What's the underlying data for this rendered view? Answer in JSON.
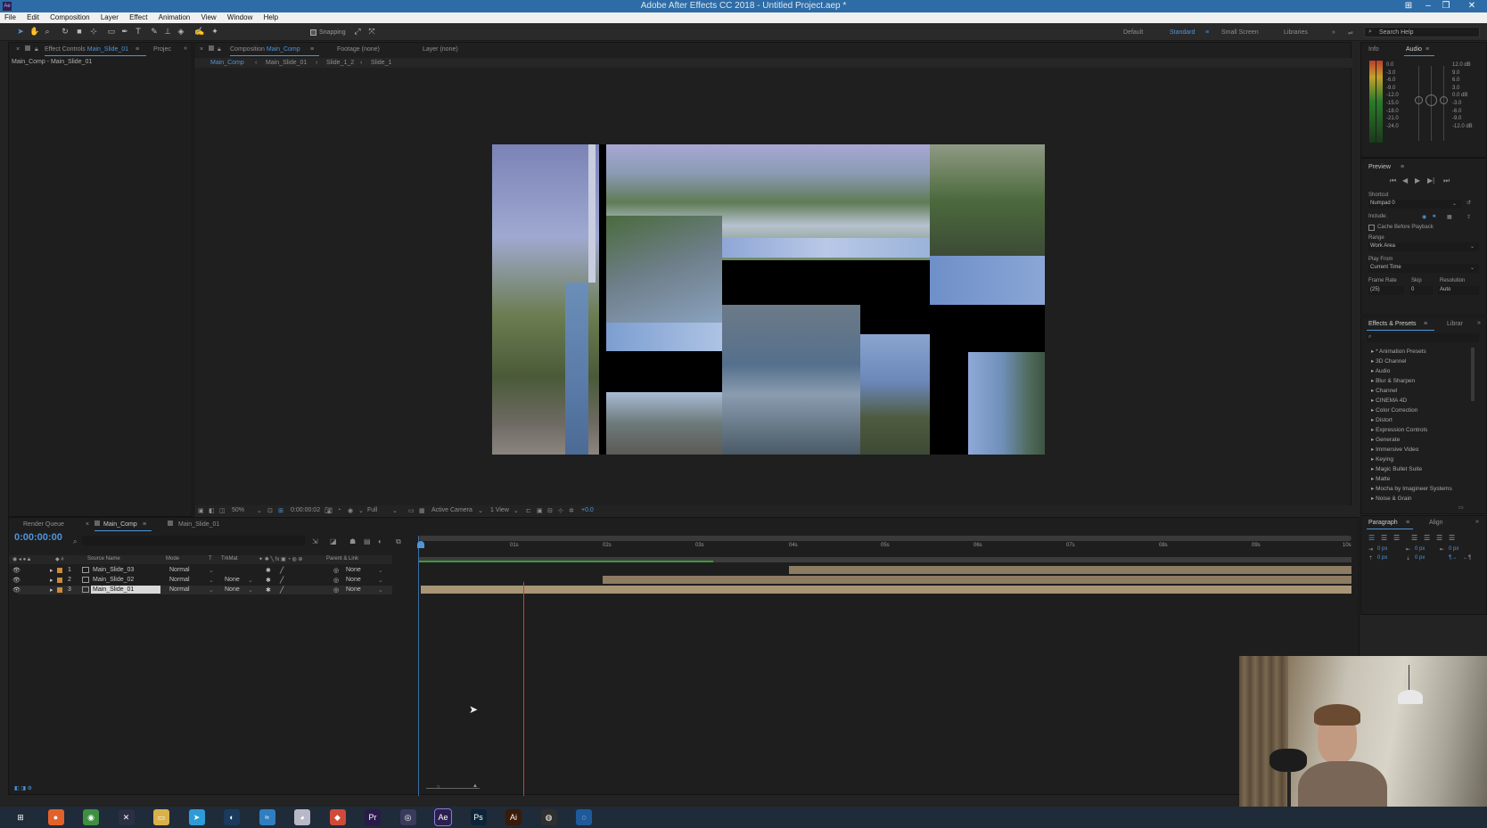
{
  "app": {
    "title": "Adobe After Effects CC 2018 - Untitled Project.aep *",
    "menu": [
      "File",
      "Edit",
      "Composition",
      "Layer",
      "Effect",
      "Animation",
      "View",
      "Window",
      "Help"
    ],
    "snapping": "Snapping",
    "workspaces": [
      "Default",
      "Standard",
      "Small Screen",
      "Libraries"
    ],
    "search_help": "Search Help"
  },
  "left_panel": {
    "tab_effect_controls": "Effect Controls",
    "tab_effect_controls_layer": "Main_Slide_01",
    "tab_project": "Projec",
    "subtitle": "Main_Comp - Main_Slide_01"
  },
  "viewer": {
    "tab_composition": "Composition",
    "tab_composition_name": "Main_Comp",
    "tab_footage": "Footage (none)",
    "tab_layer": "Layer (none)",
    "breadcrumb": [
      "Main_Comp",
      "Main_Slide_01",
      "Slide_1_2",
      "Slide_1"
    ],
    "zoom": "50%",
    "timecode": "0:00:00:02",
    "resolution": "Full",
    "camera": "Active Camera",
    "views": "1 View",
    "exposure": "+0.0"
  },
  "timeline": {
    "tab_render_queue": "Render Queue",
    "tab_main_comp": "Main_Comp",
    "tab_main_slide": "Main_Slide_01",
    "current_time": "0:00:00:00",
    "columns": {
      "source_name": "Source Name",
      "mode": "Mode",
      "t": "T",
      "trkmat": "TrkMat",
      "parent": "Parent & Link"
    },
    "layers": [
      {
        "num": "1",
        "name": "Main_Slide_03",
        "mode": "Normal",
        "trkmat": "",
        "parent": "None"
      },
      {
        "num": "2",
        "name": "Main_Slide_02",
        "mode": "Normal",
        "trkmat": "None",
        "parent": "None"
      },
      {
        "num": "3",
        "name": "Main_Slide_01",
        "mode": "Normal",
        "trkmat": "None",
        "parent": "None"
      }
    ],
    "ruler": [
      "0s",
      "01s",
      "02s",
      "03s",
      "04s",
      "05s",
      "06s",
      "07s",
      "08s",
      "09s",
      "10s"
    ]
  },
  "right_panel": {
    "info_tab": "Info",
    "audio_tab": "Audio",
    "audio_left_levels": [
      "0.0",
      "-3.0",
      "-6.0",
      "-9.0",
      "-12.0",
      "-15.0",
      "-18.0",
      "-21.0",
      "-24.0"
    ],
    "audio_right_levels": [
      "12.0 dB",
      "9.0",
      "6.0",
      "3.0",
      "0.0 dB",
      "-3.0",
      "-6.0",
      "-9.0",
      "-12.0 dB"
    ],
    "preview_tab": "Preview",
    "shortcut_label": "Shortcut",
    "shortcut_value": "Numpad 0",
    "include_label": "Include:",
    "cache_label": "Cache Before Playback",
    "range_label": "Range",
    "range_value": "Work Area",
    "play_from_label": "Play From",
    "play_from_value": "Current Time",
    "frame_rate_label": "Frame Rate",
    "skip_label": "Skip",
    "resolution_label": "Resolution",
    "frame_rate_value": "(25)",
    "skip_value": "0",
    "resolution_value": "Auto",
    "effects_tab": "Effects & Presets",
    "libraries_tab": "Librar",
    "effects": [
      "* Animation Presets",
      "3D Channel",
      "Audio",
      "Blur & Sharpen",
      "Channel",
      "CINEMA 4D",
      "Color Correction",
      "Distort",
      "Expression Controls",
      "Generate",
      "Immersive Video",
      "Keying",
      "Magic Bullet Suite",
      "Matte",
      "Mocha by Imagineer Systems",
      "Noise & Grain"
    ],
    "paragraph_tab": "Paragraph",
    "align_tab": "Align",
    "para_values": [
      "0 px",
      "0 px",
      "0 px",
      "0 px",
      "0 px"
    ]
  },
  "taskbar": {
    "apps": [
      {
        "icon": "windows-start-icon",
        "label": "⊞",
        "color": "#1f2b38"
      },
      {
        "icon": "firefox-icon",
        "label": "●",
        "color": "#e2612a"
      },
      {
        "icon": "chrome-icon",
        "label": "◉",
        "color": "#3d8f41"
      },
      {
        "icon": "terminal-icon",
        "label": "✕",
        "color": "#2a2f45"
      },
      {
        "icon": "file-explorer-icon",
        "label": "▭",
        "color": "#d8b14a"
      },
      {
        "icon": "telegram-icon",
        "label": "➤",
        "color": "#2d9bd8"
      },
      {
        "icon": "steam-icon",
        "label": "◐",
        "color": "#1b3a5c"
      },
      {
        "icon": "cloud-app-icon",
        "label": "≈",
        "color": "#2f7fc0"
      },
      {
        "icon": "app-icon-8",
        "label": "◕",
        "color": "#b8b8c8"
      },
      {
        "icon": "app-icon-9",
        "label": "◆",
        "color": "#d04a3a"
      },
      {
        "icon": "premiere-icon",
        "label": "Pr",
        "color": "#2a1a4a"
      },
      {
        "icon": "app-icon-11",
        "label": "◎",
        "color": "#3a3a5a"
      },
      {
        "icon": "after-effects-icon",
        "label": "Ae",
        "color": "#2a1f4f"
      },
      {
        "icon": "photoshop-icon",
        "label": "Ps",
        "color": "#0d2438"
      },
      {
        "icon": "illustrator-icon",
        "label": "Ai",
        "color": "#3a1a08"
      },
      {
        "icon": "obs-icon",
        "label": "◍",
        "color": "#2f2f2f"
      },
      {
        "icon": "browser-icon",
        "label": "◌",
        "color": "#1e5a9a"
      }
    ]
  }
}
